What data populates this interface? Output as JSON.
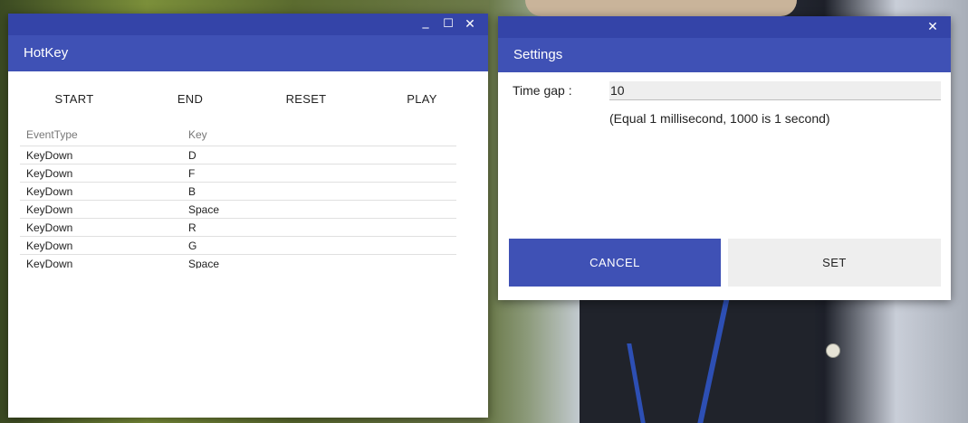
{
  "hotkey_window": {
    "title": "HotKey",
    "controls": {
      "minimize": "_",
      "maximize": "☐",
      "close": "✕"
    },
    "toolbar": {
      "start": "START",
      "end": "END",
      "reset": "RESET",
      "play": "PLAY"
    },
    "table": {
      "headers": [
        "EventType",
        "Key"
      ],
      "rows": [
        [
          "KeyDown",
          "D"
        ],
        [
          "KeyDown",
          "F"
        ],
        [
          "KeyDown",
          "B"
        ],
        [
          "KeyDown",
          "Space"
        ],
        [
          "KeyDown",
          "R"
        ],
        [
          "KeyDown",
          "G"
        ],
        [
          "KeyDown",
          "Space"
        ]
      ]
    }
  },
  "settings_window": {
    "title": "Settings",
    "close": "✕",
    "time_gap_label": "Time gap :",
    "time_gap_value": "10",
    "hint": "(Equal 1 millisecond, 1000 is 1 second)",
    "cancel_label": "CANCEL",
    "set_label": "SET"
  },
  "colors": {
    "primary": "#3f51b5",
    "titlebar": "#3444a8",
    "secondary_button": "#eeeeee"
  }
}
